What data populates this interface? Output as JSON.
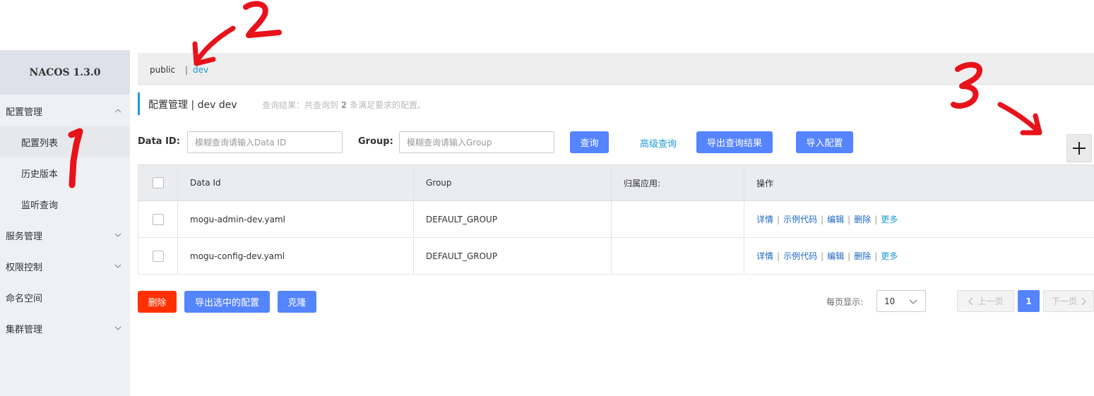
{
  "app": {
    "logo": "NACOS 1.3.0"
  },
  "sidebar": {
    "items": [
      {
        "label": "配置管理",
        "expanded": true
      },
      {
        "label": "配置列表"
      },
      {
        "label": "历史版本"
      },
      {
        "label": "监听查询"
      },
      {
        "label": "服务管理"
      },
      {
        "label": "权限控制"
      },
      {
        "label": "命名空间"
      },
      {
        "label": "集群管理"
      }
    ]
  },
  "namespace": {
    "public": "public",
    "separator": "|",
    "current": "dev"
  },
  "header": {
    "title": "配置管理 | dev dev",
    "result_prefix": "查询结果：共查询到",
    "result_count": "2",
    "result_suffix": "条满足要求的配置。"
  },
  "search": {
    "dataid_label": "Data ID:",
    "dataid_placeholder": "模糊查询请输入Data ID",
    "group_label": "Group:",
    "group_placeholder": "模糊查询请输入Group",
    "query_button": "查询",
    "advanced_link": "高级查询",
    "export_button": "导出查询结果",
    "import_button": "导入配置"
  },
  "table": {
    "headers": [
      "Data Id",
      "Group",
      "归属应用:",
      "操作"
    ],
    "rows": [
      {
        "data_id": "mogu-admin-dev.yaml",
        "group": "DEFAULT_GROUP",
        "app": ""
      },
      {
        "data_id": "mogu-config-dev.yaml",
        "group": "DEFAULT_GROUP",
        "app": ""
      }
    ],
    "actions": [
      "详情",
      "示例代码",
      "编辑",
      "删除",
      "更多"
    ]
  },
  "footer": {
    "delete_button": "删除",
    "export_selected_button": "导出选中的配置",
    "clone_button": "克隆",
    "page_size_label": "每页显示:",
    "page_size": "10",
    "prev": "上一页",
    "current_page": "1",
    "next": "下一页"
  },
  "annotations": [
    "1",
    "2",
    "3"
  ],
  "colors": {
    "primary": "#5584ff",
    "danger": "#ff3000",
    "link": "#1d9bd6",
    "annotation": "#e8121a"
  }
}
